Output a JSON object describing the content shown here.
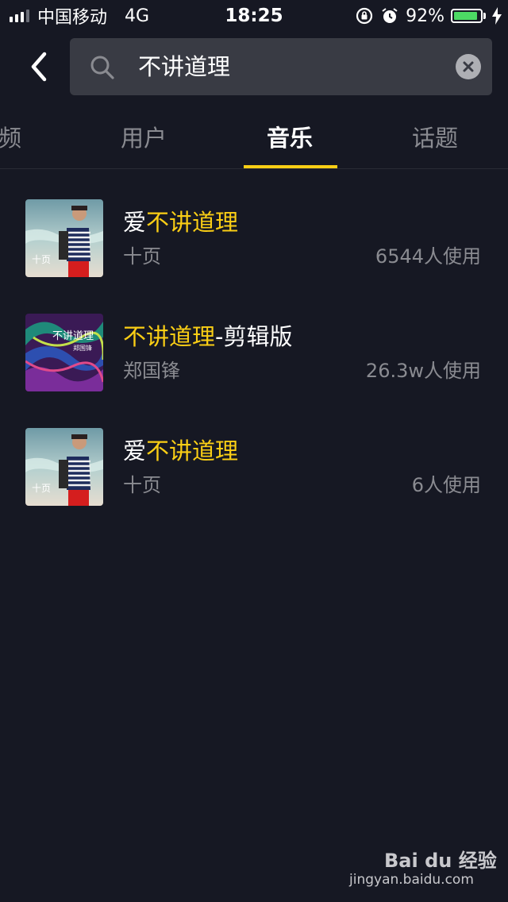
{
  "status_bar": {
    "carrier": "中国移动",
    "network": "4G",
    "time": "18:25",
    "battery_percent": "92%",
    "battery_level": 0.92,
    "battery_color": "#4cd964"
  },
  "search": {
    "query": "不讲道理",
    "back_icon": "chevron-left-icon",
    "search_icon": "search-icon",
    "clear_icon": "clear-icon"
  },
  "tabs": [
    {
      "label": "频"
    },
    {
      "label": "用户"
    },
    {
      "label": "音乐",
      "active": true
    },
    {
      "label": "话题"
    }
  ],
  "accent_color": "#face15",
  "songs": [
    {
      "title_prefix": "爱",
      "title_highlight": "不讲道理",
      "title_suffix": "",
      "artist": "十页",
      "uses": "6544人使用",
      "cover_text": "十页"
    },
    {
      "title_prefix": "",
      "title_highlight": "不讲道理",
      "title_suffix": "-剪辑版",
      "artist": "郑国锋",
      "uses": "26.3w人使用",
      "cover_text": "不讲道理",
      "cover_subtext": "郑国锋"
    },
    {
      "title_prefix": "爱",
      "title_highlight": "不讲道理",
      "title_suffix": "",
      "artist": "十页",
      "uses": "6人使用",
      "cover_text": "十页"
    }
  ],
  "watermark": {
    "brand": "Bai du 经验",
    "url": "jingyan.baidu.com"
  }
}
